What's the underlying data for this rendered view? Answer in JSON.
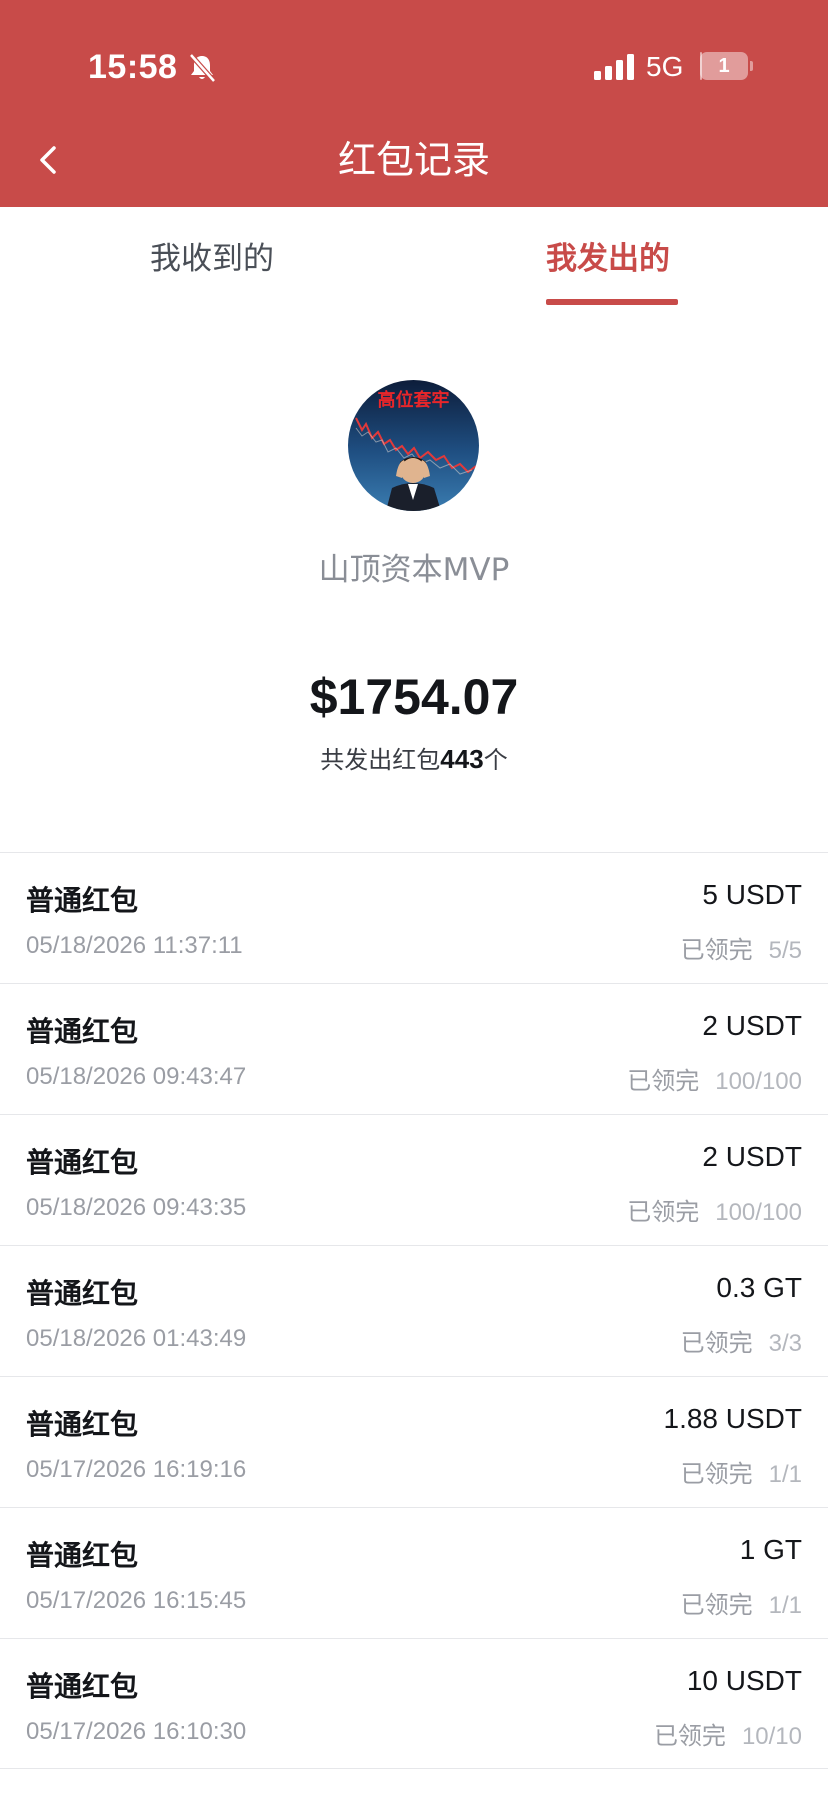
{
  "status_bar": {
    "time": "15:58",
    "network": "5G",
    "battery_level": "1",
    "battery_fraction": 0.05
  },
  "header": {
    "title": "红包记录",
    "background_color": "#c84b49"
  },
  "tabs": [
    {
      "label": "我收到的",
      "active": false
    },
    {
      "label": "我发出的",
      "active": true
    }
  ],
  "profile": {
    "avatar_caption": "高位套牢",
    "username": "山顶资本MVP"
  },
  "summary": {
    "total_amount": "$1754.07",
    "count_prefix": "共发出红包",
    "count_value": "443",
    "count_suffix": "个"
  },
  "records": [
    {
      "type": "普通红包",
      "amount": "5 USDT",
      "time": "05/18/2026 11:37:11",
      "status": "已领完",
      "claimed": "5/5"
    },
    {
      "type": "普通红包",
      "amount": "2 USDT",
      "time": "05/18/2026 09:43:47",
      "status": "已领完",
      "claimed": "100/100"
    },
    {
      "type": "普通红包",
      "amount": "2 USDT",
      "time": "05/18/2026 09:43:35",
      "status": "已领完",
      "claimed": "100/100"
    },
    {
      "type": "普通红包",
      "amount": "0.3 GT",
      "time": "05/18/2026 01:43:49",
      "status": "已领完",
      "claimed": "3/3"
    },
    {
      "type": "普通红包",
      "amount": "1.88 USDT",
      "time": "05/17/2026 16:19:16",
      "status": "已领完",
      "claimed": "1/1"
    },
    {
      "type": "普通红包",
      "amount": "1 GT",
      "time": "05/17/2026 16:15:45",
      "status": "已领完",
      "claimed": "1/1"
    },
    {
      "type": "普通红包",
      "amount": "10 USDT",
      "time": "05/17/2026 16:10:30",
      "status": "已领完",
      "claimed": "10/10"
    }
  ],
  "icons": {
    "back": "chevron-left-icon",
    "bell": "bell-muted-icon",
    "signal": "signal-bars-icon",
    "battery": "battery-icon"
  }
}
